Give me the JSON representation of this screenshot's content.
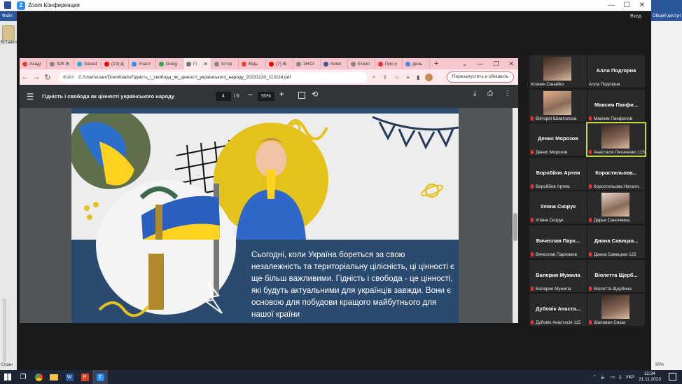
{
  "zoom": {
    "title": "Zoom Конференция",
    "signin": "Вход"
  },
  "word": {
    "file_tab": "Файл",
    "paste_label": "Вставить",
    "share_label": "Общий доступ",
    "zoom_pct": "90%",
    "page_label": "Стран"
  },
  "browser": {
    "tabs": [
      {
        "label": "Акаді",
        "color": "#e94235"
      },
      {
        "label": "325 Ж",
        "color": "#888888"
      },
      {
        "label": "Saved",
        "color": "#2ca5e0"
      },
      {
        "label": "(10) Д",
        "color": "#ff0000"
      },
      {
        "label": "Участ",
        "color": "#4285f4"
      },
      {
        "label": "Goog",
        "color": "#34a853"
      },
      {
        "label": "Гі",
        "color": "#777777",
        "active": true
      },
      {
        "label": "Істор",
        "color": "#888888"
      },
      {
        "label": "Відь",
        "color": "#ea4335"
      },
      {
        "label": "(7) Ві",
        "color": "#ff0000"
      },
      {
        "label": "ЗНО/",
        "color": "#888888"
      },
      {
        "label": "Комп",
        "color": "#3b5998"
      },
      {
        "label": "Елект",
        "color": "#888888"
      },
      {
        "label": "Про у",
        "color": "#e53935"
      },
      {
        "label": "день",
        "color": "#4285f4"
      }
    ],
    "new_tab": "+",
    "url_prefix": "Файл",
    "url": "C:/Users/user/Downloads/Гідність_і_свобода_як_цінності_українського_народу_20231120_113114.pdf",
    "relaunch": "Перезапустить и обновить"
  },
  "pdf": {
    "doc_title": "Гідність і свобода як цінності українського народу",
    "page": "4",
    "page_total": "/ 6",
    "zoom": "55%",
    "slide_text": "Сьогодні, коли Україна бореться за свою незалежність та територіальну цілісність, ці цінності є ще більш важливими. Гідність і свобода - це цінності, які будуть актуальними для українців завжди. Вони є основою для побудови кращого майбутнього для нашої країни"
  },
  "participants": [
    {
      "name": "",
      "label": "Ксения Санайко",
      "photo": true,
      "muted": false
    },
    {
      "name": "Алла Подгорна",
      "label": "Алла Подгорна",
      "photo": false,
      "muted": false
    },
    {
      "name": "",
      "label": "Вікторія Шматолоха",
      "photo": true,
      "muted": true
    },
    {
      "name": "Максим Панфи...",
      "label": "Максим Панфелов",
      "photo": false,
      "muted": true
    },
    {
      "name": "Денис Морозов",
      "label": "Денис Морозов",
      "photo": false,
      "muted": true
    },
    {
      "name": "",
      "label": "Анастасія Пятаченко 115",
      "photo": true,
      "muted": true,
      "speaking": true
    },
    {
      "name": "Воробйов Артем",
      "label": "Воробйов Артем",
      "photo": false,
      "muted": true
    },
    {
      "name": "Коростильова...",
      "label": "Коростильова Наталя.",
      "photo": false,
      "muted": true
    },
    {
      "name": "Уляна Скорук",
      "label": "Уляна Скорук",
      "photo": false,
      "muted": true
    },
    {
      "name": "",
      "label": "Дарья Саночкина",
      "photo": true,
      "muted": true
    },
    {
      "name": "Вячеслав Парх...",
      "label": "Вячеслав Пархомов",
      "photo": false,
      "muted": true
    },
    {
      "name": "Диана Савицка...",
      "label": "Диана Савицкая 125",
      "photo": false,
      "muted": true
    },
    {
      "name": "Валерия Мужила",
      "label": "Валерия Мужила",
      "photo": false,
      "muted": true
    },
    {
      "name": "Віолетта Щерб...",
      "label": "Віолетта Щербина",
      "photo": false,
      "muted": true
    },
    {
      "name": "Дубовік Анаста...",
      "label": "Дубовік Анастасія 115",
      "photo": false,
      "muted": true
    },
    {
      "name": "",
      "label": "Шаповал Саша",
      "photo": true,
      "muted": true
    }
  ],
  "taskbar": {
    "lang": "УКР",
    "time": "11:34",
    "date": "21.11.2023"
  }
}
